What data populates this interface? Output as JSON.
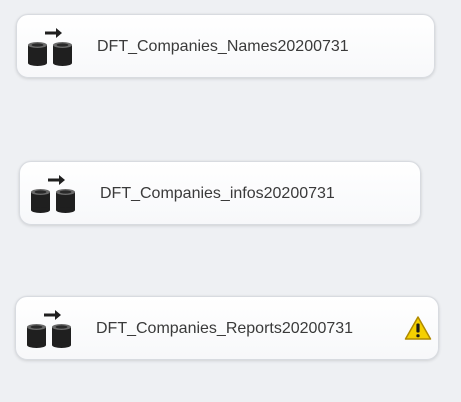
{
  "tasks": [
    {
      "name": "DFT_Companies_Names20200731",
      "icon": "data-flow-task-icon",
      "warning": false
    },
    {
      "name": "DFT_Companies_infos20200731",
      "icon": "data-flow-task-icon",
      "warning": false
    },
    {
      "name": "DFT_Companies_Reports20200731",
      "icon": "data-flow-task-icon",
      "warning": true,
      "warning_icon": "warning-icon"
    }
  ],
  "colors": {
    "canvas": "#eef0f3",
    "task_border": "#d8dbe0",
    "text": "#3a3a3a",
    "icon": "#1f1f1f",
    "warning_fill": "#f5d000"
  }
}
